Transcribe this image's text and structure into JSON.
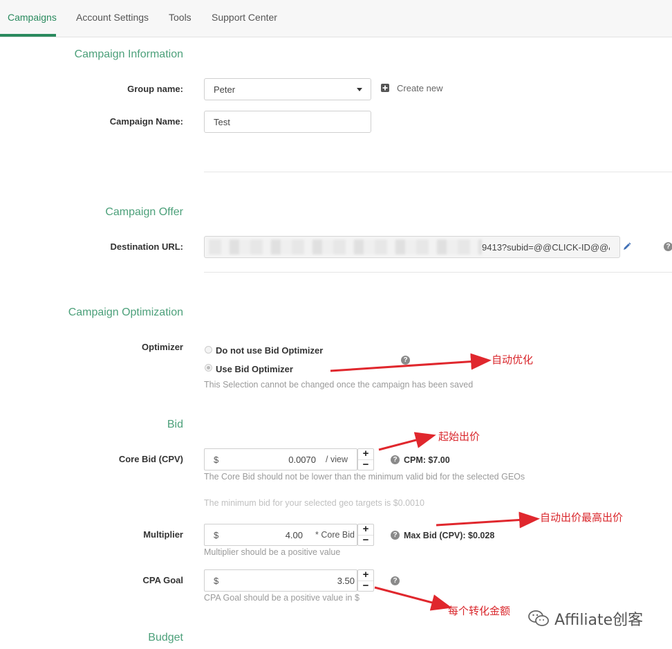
{
  "nav": {
    "tabs": [
      {
        "label": "Campaigns",
        "active": true
      },
      {
        "label": "Account Settings",
        "active": false
      },
      {
        "label": "Tools",
        "active": false
      },
      {
        "label": "Support Center",
        "active": false
      }
    ]
  },
  "campaign_info": {
    "title": "Campaign Information",
    "group_name_label": "Group name:",
    "group_name_value": "Peter",
    "create_new_label": "Create new",
    "campaign_name_label": "Campaign Name:",
    "campaign_name_value": "Test"
  },
  "campaign_offer": {
    "title": "Campaign Offer",
    "destination_url_label": "Destination URL:",
    "destination_url_visible": "9413?subid=@@CLICK-ID@@&"
  },
  "optimization": {
    "title": "Campaign Optimization",
    "optimizer_label": "Optimizer",
    "option_no": "Do not use Bid Optimizer",
    "option_yes": "Use Bid Optimizer",
    "selected": "Use Bid Optimizer",
    "note": "This Selection cannot be changed once the campaign has been saved"
  },
  "bid": {
    "title": "Bid",
    "core_bid_label": "Core Bid (CPV)",
    "currency": "$",
    "core_bid_value": "0.0070",
    "core_bid_suffix": "/ view",
    "cpm_text": "CPM: $7.00",
    "core_bid_hint": "The Core Bid should not be lower than the minimum valid bid for the selected GEOs",
    "min_bid_hint": "The minimum bid for your selected geo targets is  $0.0010",
    "multiplier_label": "Multiplier",
    "multiplier_value": "4.00",
    "multiplier_suffix": "* Core Bid",
    "max_bid_text": "Max Bid (CPV): $0.028",
    "multiplier_hint": "Multiplier should be a positive value",
    "cpa_goal_label": "CPA Goal",
    "cpa_goal_value": "3.50",
    "cpa_goal_hint": "CPA Goal should be a positive value in $"
  },
  "budget": {
    "title": "Budget"
  },
  "annotations": {
    "auto_optimize": "自动优化",
    "start_bid": "起始出价",
    "max_auto_bid": "自动出价最高出价",
    "per_conversion": "每个转化金额"
  },
  "watermark": "Affiliate创客",
  "colors": {
    "accent_green": "#2a8a5e",
    "section_title": "#4ca07a",
    "annotation_red": "#d9262b"
  }
}
